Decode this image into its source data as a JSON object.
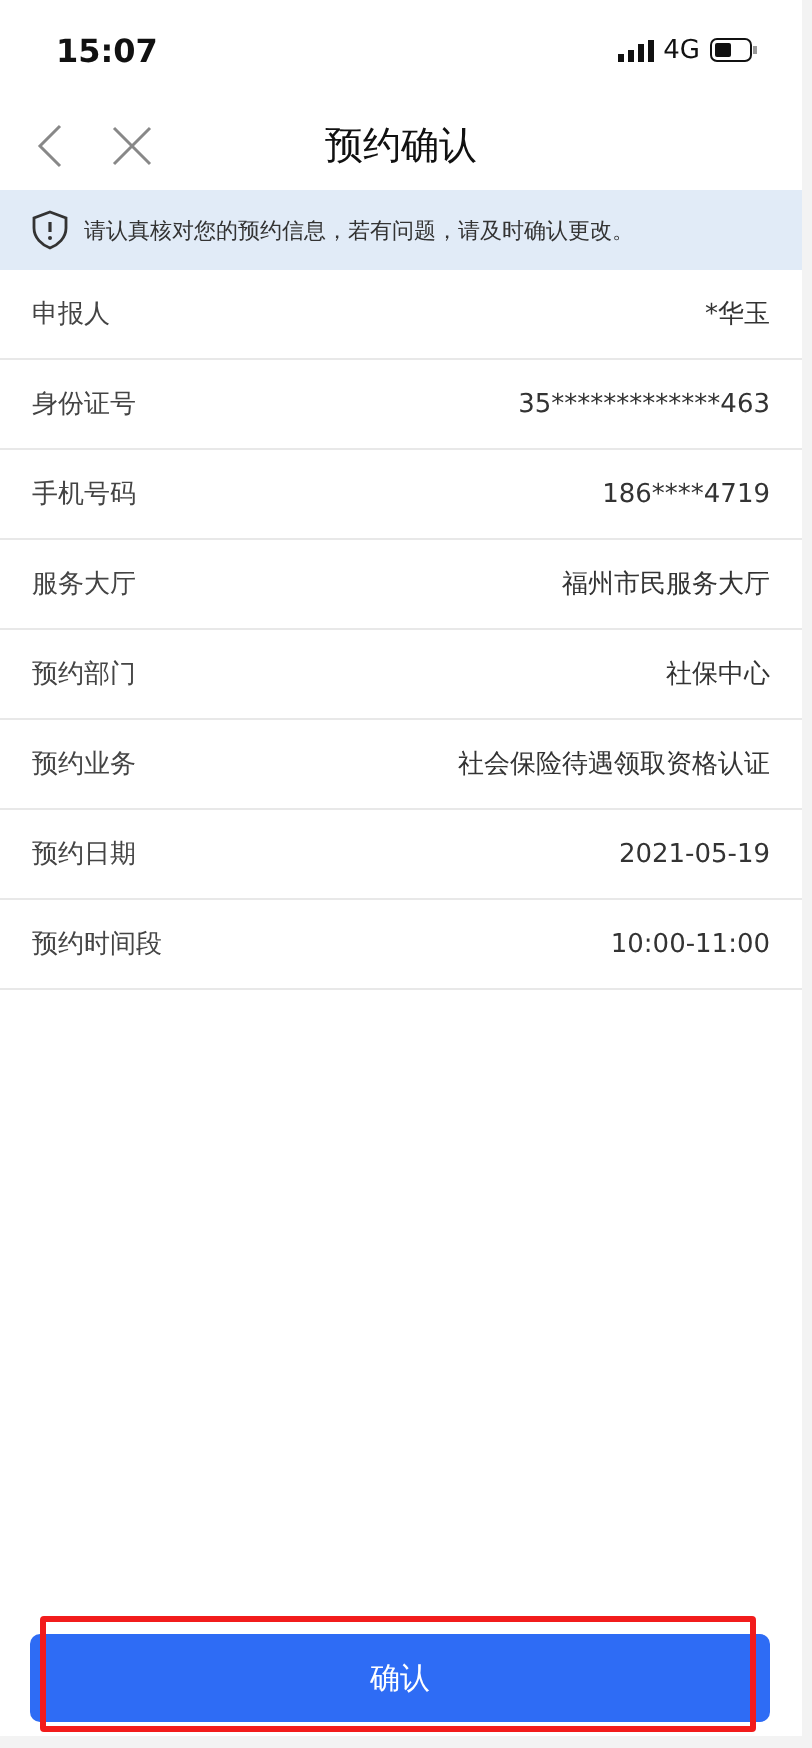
{
  "status_bar": {
    "time": "15:07",
    "network": "4G"
  },
  "nav": {
    "title": "预约确认"
  },
  "notice": {
    "text": "请认真核对您的预约信息，若有问题，请及时确认更改。"
  },
  "fields": [
    {
      "label": "申报人",
      "value": "*华玉"
    },
    {
      "label": "身份证号",
      "value": "35*************463"
    },
    {
      "label": "手机号码",
      "value": "186****4719"
    },
    {
      "label": "服务大厅",
      "value": "福州市民服务大厅"
    },
    {
      "label": "预约部门",
      "value": "社保中心"
    },
    {
      "label": "预约业务",
      "value": "社会保险待遇领取资格认证"
    },
    {
      "label": "预约日期",
      "value": "2021-05-19"
    },
    {
      "label": "预约时间段",
      "value": "10:00-11:00"
    }
  ],
  "confirm_button": {
    "label": "确认",
    "highlighted": true
  }
}
